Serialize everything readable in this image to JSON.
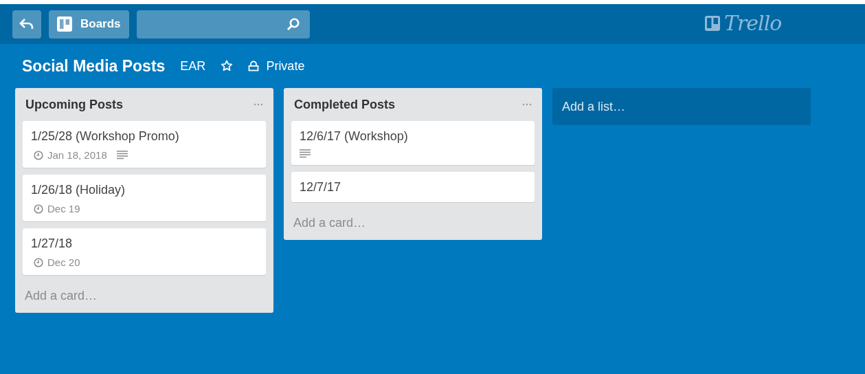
{
  "header": {
    "boards_label": "Boards",
    "logo_text": "Trello"
  },
  "board": {
    "title": "Social Media Posts",
    "team": "EAR",
    "starred": false,
    "visibility": "Private"
  },
  "lists": [
    {
      "title": "Upcoming Posts",
      "add_card": "Add a card…",
      "cards": [
        {
          "title": "1/25/28 (Workshop Promo)",
          "due": "Jan 18, 2018",
          "has_description": true
        },
        {
          "title": "1/26/18 (Holiday)",
          "due": "Dec 19",
          "has_description": false
        },
        {
          "title": "1/27/18",
          "due": "Dec 20",
          "has_description": false
        }
      ]
    },
    {
      "title": "Completed Posts",
      "add_card": "Add a card…",
      "cards": [
        {
          "title": "12/6/17 (Workshop)",
          "has_description": true
        },
        {
          "title": "12/7/17",
          "has_description": false
        }
      ]
    }
  ],
  "add_list": "Add a list…"
}
